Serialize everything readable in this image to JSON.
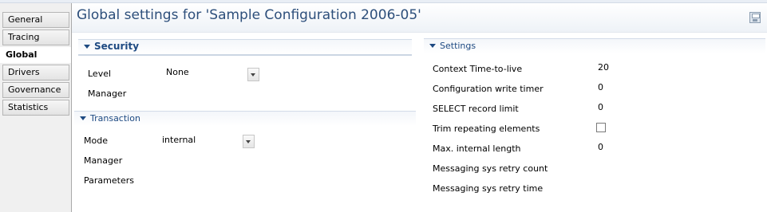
{
  "tabs": [
    "General",
    "Tracing",
    "Global",
    "Drivers",
    "Governance",
    "Statistics"
  ],
  "active_tab": "Global",
  "page_title": "Global settings for 'Sample Configuration 2006-05'",
  "security": {
    "header": "Security",
    "level_label": "Level",
    "level_value": "None",
    "manager_label": "Manager"
  },
  "transaction": {
    "header": "Transaction",
    "mode_label": "Mode",
    "mode_value": "internal",
    "manager_label": "Manager",
    "parameters_label": "Parameters"
  },
  "settings": {
    "header": "Settings",
    "rows": [
      {
        "label": "Context Time-to-live",
        "value": "20"
      },
      {
        "label": "Configuration write timer",
        "value": "0"
      },
      {
        "label": "SELECT record limit",
        "value": "0"
      },
      {
        "label": "Trim repeating elements",
        "checked": false
      },
      {
        "label": "Max. internal length",
        "value": "0"
      },
      {
        "label": "Messaging sys retry count",
        "value": ""
      },
      {
        "label": "Messaging sys retry time",
        "value": ""
      }
    ]
  }
}
